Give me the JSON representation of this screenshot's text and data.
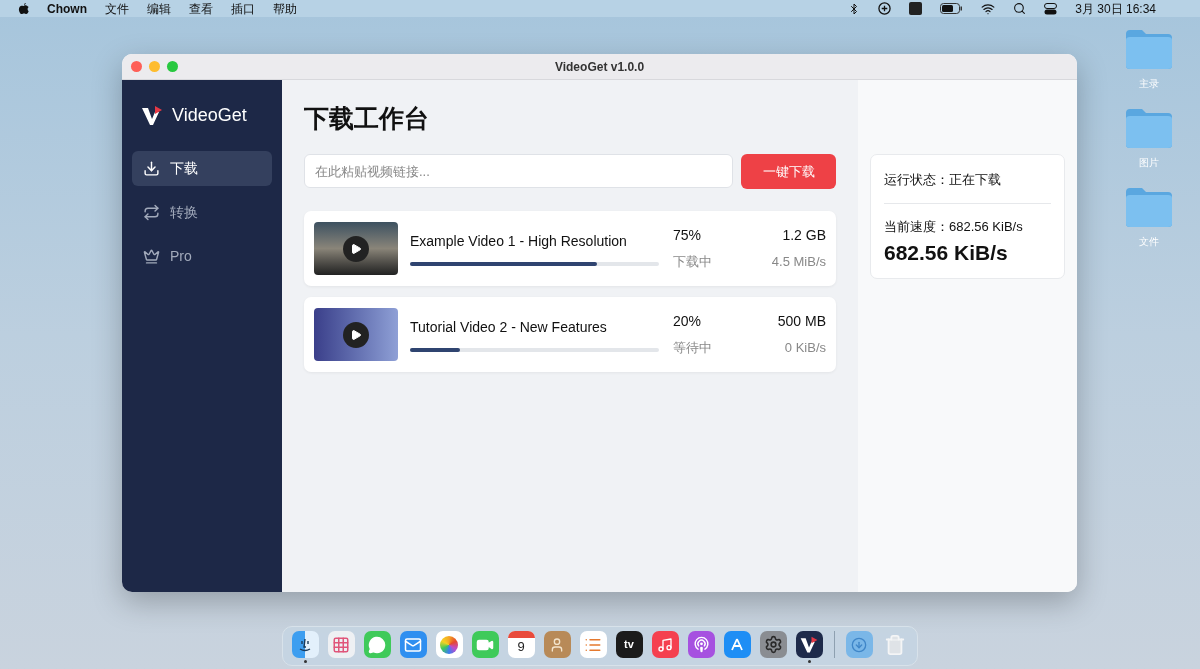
{
  "menubar": {
    "app": "Chown",
    "menus": [
      "文件",
      "编辑",
      "查看",
      "插口",
      "帮助"
    ],
    "clock": "3月 30日 16:34"
  },
  "desktop_folders": [
    {
      "label": "主录"
    },
    {
      "label": "图片"
    },
    {
      "label": "文件"
    }
  ],
  "window": {
    "title": "VideoGet v1.0.0"
  },
  "sidebar": {
    "logo": "VideoGet",
    "items": [
      {
        "label": "下载",
        "kind": "download",
        "selected": true
      },
      {
        "label": "转换",
        "kind": "convert",
        "selected": false
      },
      {
        "label": "Pro",
        "kind": "crown",
        "selected": false
      }
    ]
  },
  "main": {
    "heading": "下载工作台",
    "url_field": {
      "placeholder": "在此粘贴视频链接..."
    },
    "download_button": "一键下载",
    "downloads": [
      {
        "title": "Example Video 1 - High Resolution",
        "percent": "75%",
        "status": "下载中",
        "size": "1.2 GB",
        "speed": "4.5 MiB/s",
        "level": 0.75,
        "kind": "landscape"
      },
      {
        "title": "Tutorial Video 2 - New Features",
        "percent": "20%",
        "status": "等待中",
        "size": "500 MB",
        "speed": "0 KiB/s",
        "level": 0.2,
        "kind": "slides"
      }
    ]
  },
  "status_panel": {
    "state": "运行状态：正在下载",
    "speed_label": "当前速度：682.56 KiB/s",
    "speed": "682.56 KiB/s"
  },
  "dock": {
    "items": [
      {
        "kind": "finder",
        "running": true
      },
      {
        "kind": "launchpad",
        "running": false
      },
      {
        "kind": "messages",
        "running": false
      },
      {
        "kind": "mail",
        "running": false
      },
      {
        "kind": "photos",
        "running": false
      },
      {
        "kind": "facetime",
        "running": false
      },
      {
        "kind": "calendar",
        "label": "9",
        "running": false
      },
      {
        "kind": "contacts",
        "running": false
      },
      {
        "kind": "reminders",
        "running": false
      },
      {
        "kind": "tv",
        "label": "tv",
        "running": false
      },
      {
        "kind": "music",
        "running": false
      },
      {
        "kind": "podcasts",
        "running": false
      },
      {
        "kind": "appstore",
        "running": false
      },
      {
        "kind": "settings",
        "running": false
      },
      {
        "kind": "videoget",
        "running": true
      },
      {
        "kind": "divider",
        "running": false
      },
      {
        "kind": "downloads",
        "running": false
      },
      {
        "kind": "trash",
        "running": false
      }
    ]
  }
}
